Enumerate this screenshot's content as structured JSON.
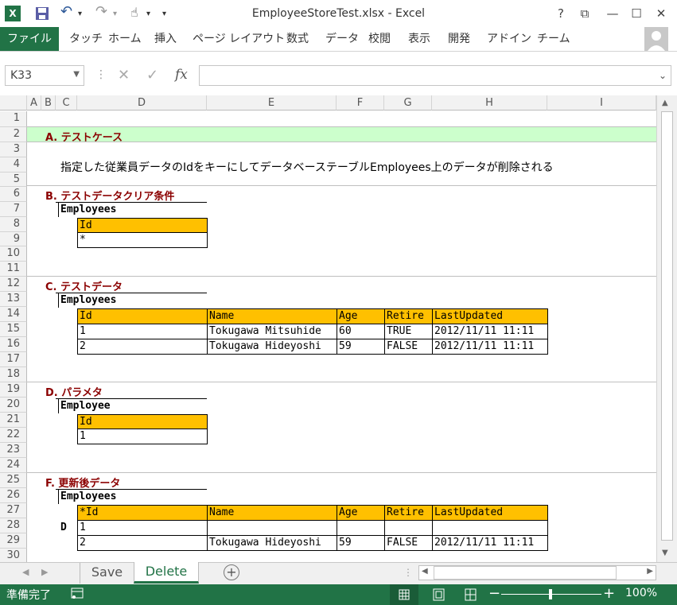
{
  "window": {
    "title": "EmployeeStoreTest.xlsx - Excel",
    "help": "?",
    "restore": "⧉",
    "minimize": "—",
    "maximize": "☐",
    "close": "✕"
  },
  "quick_access": {
    "save_icon": "save-icon",
    "undo_icon": "undo-icon",
    "redo_icon": "redo-icon",
    "touch_icon": "touch-icon"
  },
  "ribbon": {
    "file": "ファイル",
    "tabs": [
      "タッチ",
      "ホーム",
      "挿入",
      "ページ レイアウト",
      "数式",
      "データ",
      "校閲",
      "表示",
      "開発",
      "アドイン",
      "チーム"
    ]
  },
  "formula_bar": {
    "name_box": "K33",
    "formula": "",
    "fx": "fx"
  },
  "columns": [
    "A",
    "B",
    "C",
    "D",
    "E",
    "F",
    "G",
    "H",
    "I"
  ],
  "rows": [
    "1",
    "2",
    "3",
    "4",
    "5",
    "6",
    "7",
    "8",
    "9",
    "10",
    "11",
    "12",
    "13",
    "14",
    "15",
    "16",
    "17",
    "18",
    "19",
    "20",
    "21",
    "22",
    "23",
    "24",
    "25",
    "26",
    "27",
    "28",
    "29",
    "30"
  ],
  "sheet": {
    "section_a": {
      "title": "A. テストケース",
      "description": "指定した従業員データのIdをキーにしてデータベーステーブルEmployees上のデータが削除される"
    },
    "section_b": {
      "title": "B. テストデータクリア条件",
      "table": "Employees",
      "header": "Id",
      "value": "*"
    },
    "section_c": {
      "title": "C. テストデータ",
      "table": "Employees",
      "headers": [
        "Id",
        "Name",
        "Age",
        "Retire",
        "LastUpdated"
      ],
      "rows": [
        [
          "1",
          "Tokugawa Mitsuhide",
          "60",
          "TRUE",
          "2012/11/11 11:11"
        ],
        [
          "2",
          "Tokugawa Hideyoshi",
          "59",
          "FALSE",
          "2012/11/11 11:11"
        ]
      ]
    },
    "section_d": {
      "title": "D. パラメタ",
      "table": "Employee",
      "header": "Id",
      "value": "1"
    },
    "section_f": {
      "title": "F. 更新後データ",
      "table": "Employees",
      "headers": [
        "*Id",
        "Name",
        "Age",
        "Retire",
        "LastUpdated"
      ],
      "marker": "D",
      "rows": [
        [
          "1",
          "",
          "",
          "",
          ""
        ],
        [
          "2",
          "Tokugawa Hideyoshi",
          "59",
          "FALSE",
          "2012/11/11 11:11"
        ]
      ]
    }
  },
  "sheet_tabs": [
    "Save",
    "Delete"
  ],
  "status": {
    "ready": "準備完了",
    "zoom": "100%",
    "minus": "−",
    "plus": "+"
  },
  "colors": {
    "excel_green": "#217346",
    "header_yellow": "#ffc000",
    "section_green": "#ccffcc",
    "section_red": "#8b0000"
  }
}
